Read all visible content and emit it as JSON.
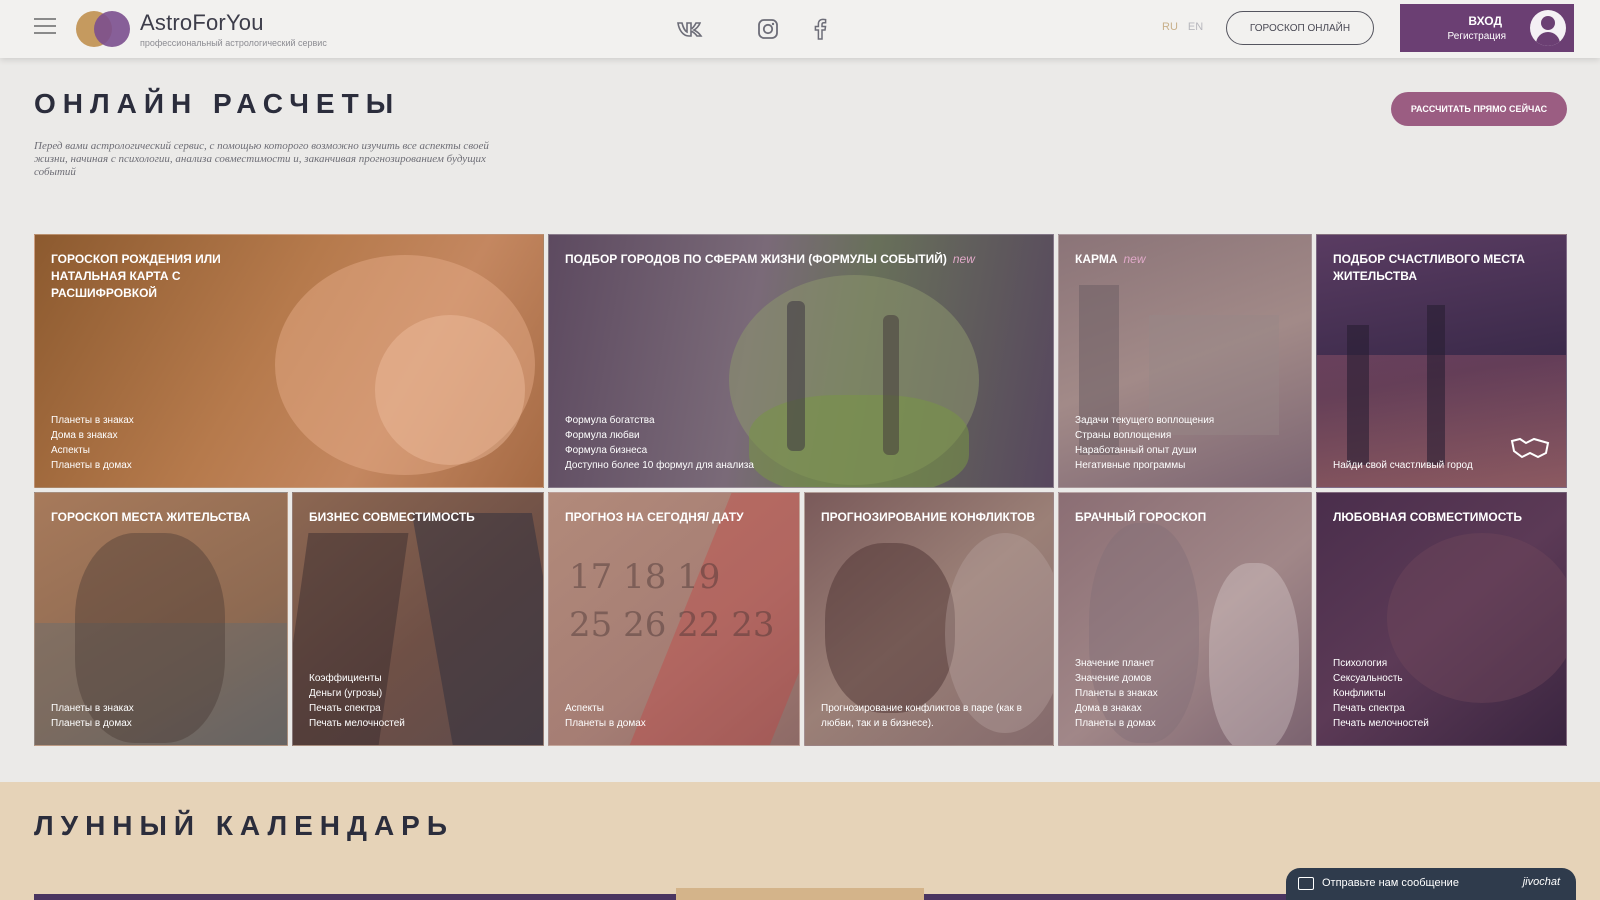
{
  "header": {
    "logo_title": "AstroForYou",
    "logo_subtitle": "профессиональный астрологический сервис",
    "social": [
      "vk-icon",
      "instagram-icon",
      "facebook-icon"
    ],
    "lang_ru": "RU",
    "lang_en": "EN",
    "horoscope_button": "ГОРОСКОП ОНЛАЙН",
    "login_label": "ВХОД",
    "register_label": "Регистрация"
  },
  "section1": {
    "title": "ОНЛАЙН РАСЧЕТЫ",
    "description": "Перед вами астрологический сервис, с помощью которого возможно изучить все аспекты своей жизни, начиная с психологии, анализа совместимости и, заканчивая прогнозированием будущих событий",
    "cta": "РАССЧИТАТЬ ПРЯМО СЕЙЧАС"
  },
  "cards": [
    {
      "id": "natal",
      "title": "ГОРОСКОП РОЖДЕНИЯ ИЛИ НАТАЛЬНАЯ КАРТА С РАСШИФРОВКОЙ",
      "new": "",
      "items": [
        "Планеты в знаках",
        "Дома в знаках",
        "Аспекты",
        "Планеты в домах"
      ]
    },
    {
      "id": "cities",
      "title": "ПОДБОР ГОРОДОВ ПО СФЕРАМ ЖИЗНИ (ФОРМУЛЫ СОБЫТИЙ)",
      "new": "new",
      "items": [
        "Формула богатства",
        "Формула любви",
        "Формула бизнеса",
        "Доступно более 10 формул для анализа"
      ]
    },
    {
      "id": "karma",
      "title": "КАРМА",
      "new": "new",
      "items": [
        "Задачи текущего воплощения",
        "Страны воплощения",
        "Наработанный опыт души",
        "Негативные программы"
      ]
    },
    {
      "id": "happy",
      "title": "ПОДБОР СЧАСТЛИВОГО МЕСТА ЖИТЕЛЬСТВА",
      "new": "",
      "items": [
        "Найди свой счастливый город"
      ]
    },
    {
      "id": "place",
      "title": "ГОРОСКОП МЕСТА ЖИТЕЛЬСТВА",
      "new": "",
      "items": [
        "Планеты в знаках",
        "Планеты в домах"
      ]
    },
    {
      "id": "biz",
      "title": "БИЗНЕС СОВМЕСТИМОСТЬ",
      "new": "",
      "items": [
        "Коэффициенты",
        "Деньги (угрозы)",
        "Печать спектра",
        "Печать мелочностей"
      ]
    },
    {
      "id": "date",
      "title": "ПРОГНОЗ НА СЕГОДНЯ/ ДАТУ",
      "new": "",
      "items": [
        "Аспекты",
        "Планеты в домах"
      ]
    },
    {
      "id": "conf",
      "title": "ПРОГНОЗИРОВАНИЕ КОНФЛИКТОВ",
      "new": "",
      "items": [
        "Прогнозирование конфликтов в паре (как в любви, так и в бизнесе)."
      ]
    },
    {
      "id": "wed",
      "title": "БРАЧНЫЙ ГОРОСКОП",
      "new": "",
      "items": [
        "Значение планет",
        "Значение домов",
        "Планеты в знаках",
        "Дома в знаках",
        "Планеты в домах"
      ]
    },
    {
      "id": "love",
      "title": "ЛЮБОВНАЯ СОВМЕСТИМОСТЬ",
      "new": "",
      "items": [
        "Психология",
        "Сексуальность",
        "Конфликты",
        "Печать спектра",
        "Печать мелочностей"
      ]
    }
  ],
  "section2": {
    "title": "ЛУННЫЙ КАЛЕНДАРЬ"
  },
  "chat": {
    "label": "Отправьте нам сообщение",
    "brand": "jivochat"
  }
}
